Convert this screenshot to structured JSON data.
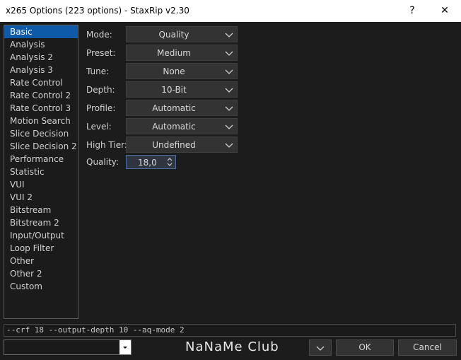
{
  "window": {
    "title": "x265 Options (223 options) - StaxRip v2.30",
    "help_label": "?",
    "close_label": "✕"
  },
  "nav": {
    "items": [
      {
        "label": "Basic",
        "selected": true
      },
      {
        "label": "Analysis"
      },
      {
        "label": "Analysis 2"
      },
      {
        "label": "Analysis 3"
      },
      {
        "label": "Rate Control"
      },
      {
        "label": "Rate Control 2"
      },
      {
        "label": "Rate Control 3"
      },
      {
        "label": "Motion Search"
      },
      {
        "label": "Slice Decision"
      },
      {
        "label": "Slice Decision 2"
      },
      {
        "label": "Performance"
      },
      {
        "label": "Statistic"
      },
      {
        "label": "VUI"
      },
      {
        "label": "VUI 2"
      },
      {
        "label": "Bitstream"
      },
      {
        "label": "Bitstream 2"
      },
      {
        "label": "Input/Output"
      },
      {
        "label": "Loop Filter"
      },
      {
        "label": "Other"
      },
      {
        "label": "Other 2"
      },
      {
        "label": "Custom"
      }
    ]
  },
  "form": {
    "mode": {
      "label": "Mode:",
      "value": "Quality"
    },
    "preset": {
      "label": "Preset:",
      "value": "Medium"
    },
    "tune": {
      "label": "Tune:",
      "value": "None"
    },
    "depth": {
      "label": "Depth:",
      "value": "10-Bit"
    },
    "profile": {
      "label": "Profile:",
      "value": "Automatic"
    },
    "level": {
      "label": "Level:",
      "value": "Automatic"
    },
    "high_tier": {
      "label": "High Tier:",
      "value": "Undefined"
    },
    "quality": {
      "label": "Quality:",
      "value": "18,0"
    }
  },
  "command_line": "--crf 18 --output-depth 10 --aq-mode 2",
  "footer": {
    "logo_text": "NaNaMe Club",
    "ok_label": "OK",
    "cancel_label": "Cancel"
  },
  "colors": {
    "selection": "#0e5aa8",
    "background": "#1c1c1c",
    "control": "#333333"
  }
}
